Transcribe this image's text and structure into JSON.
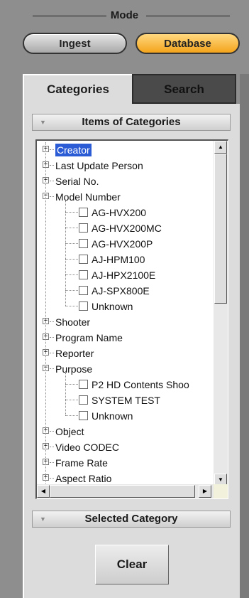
{
  "mode": {
    "title": "Mode",
    "buttons": [
      {
        "label": "Ingest",
        "active": false
      },
      {
        "label": "Database",
        "active": true
      }
    ],
    "active_color": "#f6a81f"
  },
  "tabs": [
    {
      "label": "Categories",
      "active": true
    },
    {
      "label": "Search",
      "active": false
    }
  ],
  "items_section": {
    "title": "Items of Categories"
  },
  "tree": [
    {
      "label": "Creator",
      "level": 0,
      "expander": "+",
      "selected": true
    },
    {
      "label": "Last Update Person",
      "level": 0,
      "expander": "+"
    },
    {
      "label": "Serial No.",
      "level": 0,
      "expander": "+"
    },
    {
      "label": "Model Number",
      "level": 0,
      "expander": "-"
    },
    {
      "label": "AG-HVX200",
      "level": 1,
      "checkbox": true,
      "checked": false
    },
    {
      "label": "AG-HVX200MC",
      "level": 1,
      "checkbox": true,
      "checked": false
    },
    {
      "label": "AG-HVX200P",
      "level": 1,
      "checkbox": true,
      "checked": false
    },
    {
      "label": "AJ-HPM100",
      "level": 1,
      "checkbox": true,
      "checked": false
    },
    {
      "label": "AJ-HPX2100E",
      "level": 1,
      "checkbox": true,
      "checked": false
    },
    {
      "label": "AJ-SPX800E",
      "level": 1,
      "checkbox": true,
      "checked": false
    },
    {
      "label": "Unknown",
      "level": 1,
      "checkbox": true,
      "checked": false
    },
    {
      "label": "Shooter",
      "level": 0,
      "expander": "+"
    },
    {
      "label": "Program Name",
      "level": 0,
      "expander": "+"
    },
    {
      "label": "Reporter",
      "level": 0,
      "expander": "+"
    },
    {
      "label": "Purpose",
      "level": 0,
      "expander": "-"
    },
    {
      "label": "P2 HD Contents Shoo",
      "level": 1,
      "checkbox": true,
      "checked": false
    },
    {
      "label": "SYSTEM TEST",
      "level": 1,
      "checkbox": true,
      "checked": false
    },
    {
      "label": "Unknown",
      "level": 1,
      "checkbox": true,
      "checked": false
    },
    {
      "label": "Object",
      "level": 0,
      "expander": "+"
    },
    {
      "label": "Video CODEC",
      "level": 0,
      "expander": "+"
    },
    {
      "label": "Frame Rate",
      "level": 0,
      "expander": "+"
    },
    {
      "label": "Aspect Ratio",
      "level": 0,
      "expander": "+"
    }
  ],
  "scrollbar_icons": {
    "up": "up-arrow-icon",
    "down": "down-arrow-icon",
    "left": "left-arrow-icon",
    "right": "right-arrow-icon"
  },
  "selected_section": {
    "title": "Selected Category"
  },
  "clear_button": {
    "label": "Clear"
  }
}
